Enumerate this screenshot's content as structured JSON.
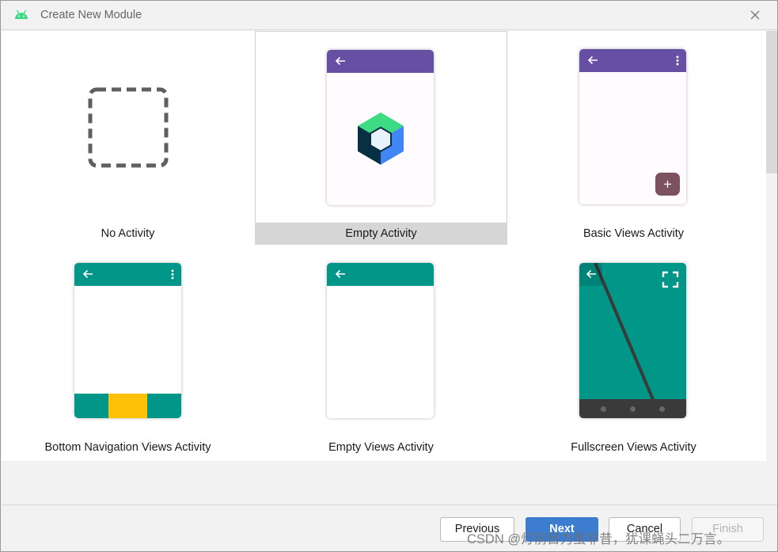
{
  "window": {
    "title": "Create New Module"
  },
  "templates": [
    {
      "id": "no-activity",
      "label": "No Activity",
      "selected": false
    },
    {
      "id": "empty-activity",
      "label": "Empty Activity",
      "selected": true
    },
    {
      "id": "basic-views-activity",
      "label": "Basic Views Activity",
      "selected": false
    },
    {
      "id": "bottom-navigation-views-activity",
      "label": "Bottom Navigation Views Activity",
      "selected": false
    },
    {
      "id": "empty-views-activity",
      "label": "Empty Views Activity",
      "selected": false
    },
    {
      "id": "fullscreen-views-activity",
      "label": "Fullscreen Views Activity",
      "selected": false
    }
  ],
  "buttons": {
    "previous": "Previous",
    "next": "Next",
    "cancel": "Cancel",
    "finish": "Finish"
  },
  "watermark": "CSDN @灯前目力虽非昔，犹课蝇头二万言。",
  "colors": {
    "compose_purple": "#6750a4",
    "fab_color": "#7d5260",
    "views_teal": "#009688",
    "bottom_nav_accent": "#ffc107",
    "primary_button": "#3d7dd0",
    "android_green": "#3ddc84"
  },
  "icons": {
    "window_icon": "android-icon",
    "close": "close-icon",
    "back": "back-arrow-icon",
    "menu": "kebab-menu-icon",
    "fab": "plus-icon",
    "compose": "jetpack-compose-icon",
    "fullscreen": "fullscreen-icon"
  }
}
